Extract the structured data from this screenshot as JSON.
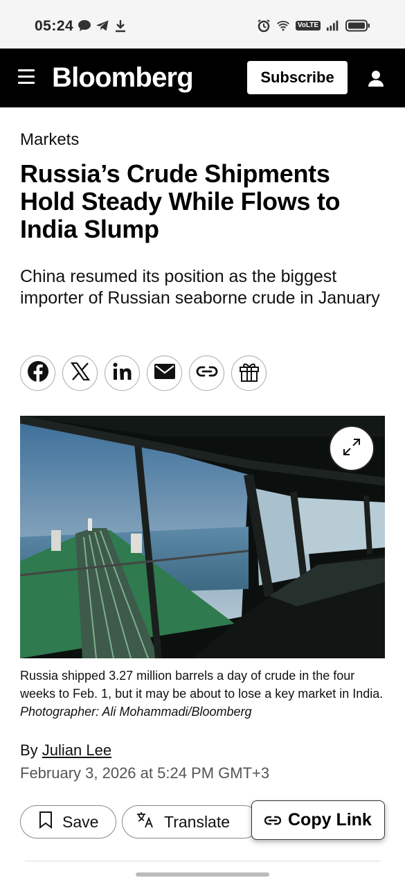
{
  "status_bar": {
    "time": "05:24",
    "volte": "VoLTE",
    "left_icons": [
      "chat-bubble-icon",
      "telegram-icon",
      "download-icon"
    ],
    "right_icons": [
      "alarm-icon",
      "wifi-icon",
      "volte-icon",
      "signal-icon",
      "battery-icon"
    ]
  },
  "header": {
    "brand": "Bloomberg",
    "subscribe_label": "Subscribe"
  },
  "article": {
    "category": "Markets",
    "headline": "Russia’s Crude Shipments Hold Steady While Flows to India Slump",
    "dek": "China resumed its position as the biggest importer of Russian seaborne crude in January",
    "share_icons": [
      "facebook-icon",
      "x-icon",
      "linkedin-icon",
      "email-icon",
      "link-icon",
      "gift-icon"
    ],
    "caption_text": "Russia shipped 3.27 million barrels a day of crude in the four weeks to Feb. 1, but it may be about to lose a key market in India. ",
    "caption_credit": "Photographer: Ali Mohammadi/Bloomberg",
    "byline_prefix": "By ",
    "author": "Julian Lee",
    "date": "February 3, 2026 at 5:24 PM GMT+3"
  },
  "actions": {
    "save_label": "Save",
    "translate_label": "Translate",
    "copy_link_label": "Copy Link"
  }
}
